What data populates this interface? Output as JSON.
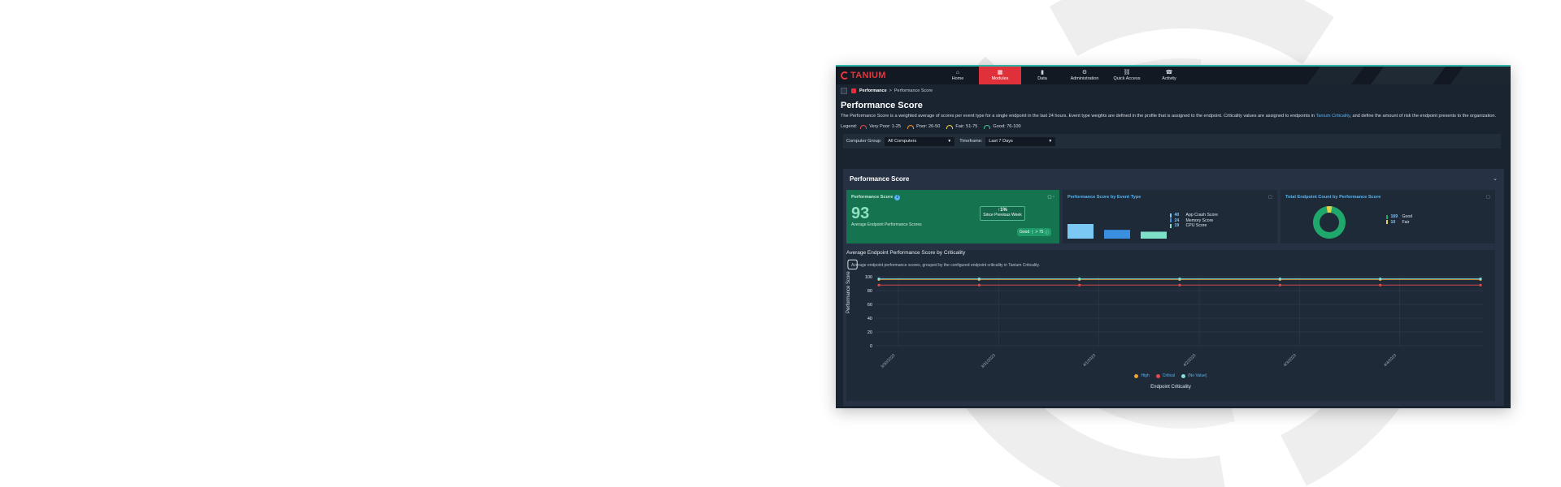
{
  "nav": {
    "logo": "TANIUM",
    "items": [
      {
        "label": "Home",
        "icon": "home-icon",
        "glyph": "⌂"
      },
      {
        "label": "Modules",
        "icon": "modules-grid-icon",
        "glyph": "▦",
        "active": true
      },
      {
        "label": "Data",
        "icon": "data-bars-icon",
        "glyph": "▮"
      },
      {
        "label": "Administration",
        "icon": "gear-icon",
        "glyph": "⚙"
      },
      {
        "label": "Quick Access",
        "icon": "link-icon",
        "glyph": "⛓"
      },
      {
        "label": "Activity",
        "icon": "activity-icon",
        "glyph": "☎"
      }
    ]
  },
  "breadcrumb": {
    "module": "Performance",
    "separator": ">",
    "page": "Performance Score"
  },
  "page": {
    "title": "Performance Score",
    "description_part1": "The Performance Score is a weighted average of scores per event type for a single endpoint in the last 24 hours. Event type weights are defined in the profile that is assigned to the endpoint. Criticality values are assigned to endpoints in ",
    "description_link": "Tanium Criticality",
    "description_part2": ", and define the amount of risk the endpoint presents to the organization."
  },
  "legend": {
    "label": "Legend:",
    "items": [
      {
        "text": "Very Poor: 1-25",
        "color": "#e24a4a"
      },
      {
        "text": "Poor: 26-50",
        "color": "#f0913a"
      },
      {
        "text": "Fair: 51-75",
        "color": "#e3d34a"
      },
      {
        "text": "Good: 76-100",
        "color": "#3fc490"
      }
    ]
  },
  "filters": {
    "group_label": "Computer Group:",
    "group_value": "All Computers",
    "timeframe_label": "Timeframe:",
    "timeframe_value": "Last 7 Days"
  },
  "panel": {
    "title": "Performance Score"
  },
  "score_card": {
    "title": "Performance Score",
    "value": "93",
    "subtitle": "Average Endpoint Performance Scores",
    "delta_value": "↑1%",
    "delta_label": "Since Previous Week",
    "badge_label": "Good",
    "badge_value": "> 75"
  },
  "event_card": {
    "title": "Performance Score by Event Type",
    "chart_data": {
      "type": "bar",
      "categories": [
        "App Crash Score",
        "Memory Score",
        "CPU Score"
      ],
      "values": [
        40,
        24,
        19
      ],
      "colors": [
        "#7cc8f5",
        "#3b8fe0",
        "#7fe0c8"
      ]
    }
  },
  "count_card": {
    "title_part1": "Total Endpoint Count by ",
    "title_part2": "Performance Score",
    "chart_data": {
      "type": "pie",
      "categories": [
        "Good",
        "Fair"
      ],
      "values": [
        169,
        10
      ],
      "colors": [
        "#1fa86b",
        "#e3d34a"
      ]
    }
  },
  "criticality_card": {
    "title": "Average Endpoint Performance Score by Criticality",
    "subtitle": "Average endpoint performance scores, grouped by the configured endpoint criticality in Tanium Criticality.",
    "chart_data": {
      "type": "line",
      "x": [
        "3/30/2023",
        "3/31/2023",
        "4/1/2023",
        "4/2/2023",
        "4/3/2023",
        "4/4/2023",
        "4/5/2023"
      ],
      "ylabel": "Performance Score",
      "xlabel": "Endpoint Criticality",
      "ylim": [
        0,
        100
      ],
      "yticks": [
        0,
        20,
        40,
        60,
        80,
        100
      ],
      "xtick_labels": [
        "3/30/2023",
        "3/31/2023",
        "4/1/2023",
        "4/2/2023",
        "4/3/2023",
        "4/4/2023"
      ],
      "grid": true,
      "series": [
        {
          "name": "High",
          "color": "#f0a030",
          "values": [
            96,
            96,
            96,
            96,
            96,
            96,
            96
          ]
        },
        {
          "name": "Critical",
          "color": "#e24a4a",
          "values": [
            88,
            88,
            88,
            88,
            88,
            88,
            88
          ]
        },
        {
          "name": "(No Value)",
          "color": "#7fe0e0",
          "values": [
            97,
            97,
            97,
            97,
            97,
            97,
            97
          ]
        }
      ]
    }
  }
}
